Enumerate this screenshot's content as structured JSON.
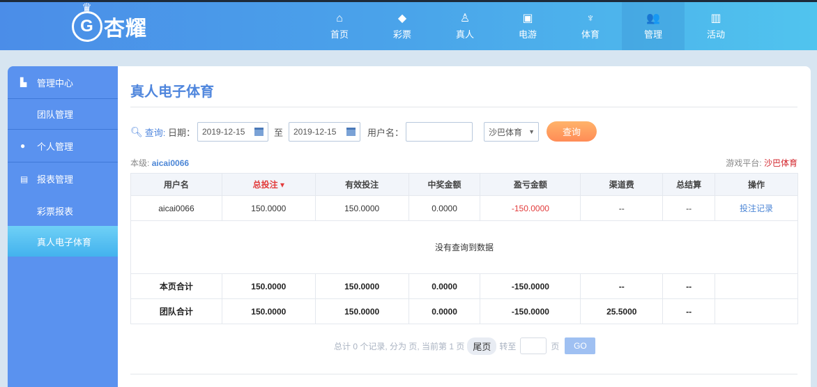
{
  "logo": {
    "text": "杏耀"
  },
  "nav": [
    {
      "label": "首页",
      "icon": "home-icon",
      "glyph": "⌂"
    },
    {
      "label": "彩票",
      "icon": "ticket-icon",
      "glyph": "◆"
    },
    {
      "label": "真人",
      "icon": "dealer-icon",
      "glyph": "♙"
    },
    {
      "label": "电游",
      "icon": "slot-machine-icon",
      "glyph": "▣"
    },
    {
      "label": "体育",
      "icon": "trophy-icon",
      "glyph": "♆"
    },
    {
      "label": "管理",
      "icon": "users-icon",
      "glyph": "👥"
    },
    {
      "label": "活动",
      "icon": "gift-icon",
      "glyph": "▥"
    }
  ],
  "sidebar": {
    "items": [
      {
        "label": "管理中心"
      },
      {
        "label": "团队管理"
      },
      {
        "label": "个人管理"
      },
      {
        "label": "报表管理"
      },
      {
        "label": "彩票报表"
      },
      {
        "label": "真人电子体育"
      }
    ]
  },
  "page": {
    "title": "真人电子体育"
  },
  "query": {
    "label": "查询:",
    "date_label": "日期：",
    "start": "2019-12-15",
    "to": "至",
    "end": "2019-12-15",
    "user_label": "用户名：",
    "user_value": "",
    "platform": "沙巴体育",
    "button": "查询"
  },
  "meta": {
    "level_label": "本级:",
    "level_user": "aicai0066",
    "platform_label": "游戏平台:",
    "platform_value": "沙巴体育"
  },
  "table": {
    "headers": [
      "用户名",
      "总投注 ▾",
      "有效投注",
      "中奖金额",
      "盈亏金额",
      "渠道费",
      "总结算",
      "操作"
    ],
    "row": [
      "aicai0066",
      "150.0000",
      "150.0000",
      "0.0000",
      "-150.0000",
      "--",
      "--",
      "投注记录"
    ],
    "empty": "没有查询到数据",
    "page_total": [
      "本页合计",
      "150.0000",
      "150.0000",
      "0.0000",
      "-150.0000",
      "--",
      "--",
      ""
    ],
    "team_total": [
      "团队合计",
      "150.0000",
      "150.0000",
      "0.0000",
      "-150.0000",
      "25.5000",
      "--",
      ""
    ]
  },
  "pager": {
    "summary": "总计 0 个记录, 分为 页, 当前第 1 页",
    "last": "尾页",
    "goto": "转至",
    "page": "页",
    "go": "GO"
  }
}
